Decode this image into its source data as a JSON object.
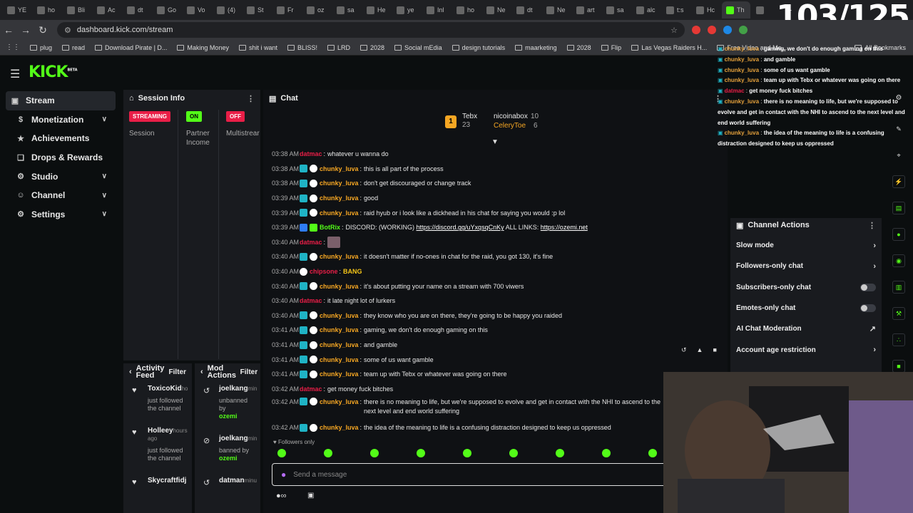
{
  "browser": {
    "tabs": [
      "YE",
      "ho",
      "Bli",
      "Ac",
      "dt",
      "Go",
      "Vo",
      "(4)",
      "St",
      "Fr",
      "oz",
      "sa",
      "He",
      "ye",
      "Inl",
      "ho",
      "Ne",
      "dt",
      "Ne",
      "art",
      "sa",
      "alc",
      "t:s",
      "Hc",
      "Th",
      ""
    ],
    "url": "dashboard.kick.com/stream",
    "bookmarks": [
      "plug",
      "read",
      "Download Pirate | D...",
      "Making Money",
      "shit i want",
      "BLISS!",
      "LRD",
      "2028",
      "Social mEdia",
      "design tutorials",
      "maarketing",
      "2028",
      "Flip",
      "Las Vegas Raiders H...",
      "Free Video and Me...",
      "All Bookmarks"
    ],
    "overlay_counter": "103/125"
  },
  "brand": {
    "logo": "KICK",
    "beta": "BETA",
    "accent": "#53fc18"
  },
  "sidebar": {
    "items": [
      {
        "label": "Stream",
        "icon": "stream-icon",
        "active": true
      },
      {
        "label": "Monetization",
        "icon": "dollar-icon",
        "expandable": true
      },
      {
        "label": "Achievements",
        "icon": "trophy-icon"
      },
      {
        "label": "Drops & Rewards",
        "icon": "gift-icon"
      },
      {
        "label": "Studio",
        "icon": "gear-icon",
        "expandable": true
      },
      {
        "label": "Channel",
        "icon": "person-icon",
        "expandable": true
      },
      {
        "label": "Settings",
        "icon": "settings-icon",
        "expandable": true
      }
    ]
  },
  "session": {
    "title": "Session Info",
    "cols": [
      {
        "pill": "STREAMING",
        "pill_color": "#e91e47",
        "label": "Session"
      },
      {
        "pill": "ON",
        "pill_color": "#53fc18",
        "label": "Partner Income"
      },
      {
        "pill": "OFF",
        "pill_color": "#e91e47",
        "label": "Multistrear"
      }
    ]
  },
  "activity": {
    "title": "Activity Feed",
    "filter": "Filter",
    "items": [
      {
        "name": "ToxicoKid",
        "suffix": "ho",
        "text": "just followed the channel"
      },
      {
        "name": "Holleey",
        "suffix": "hours ago",
        "text": "just followed the channel"
      },
      {
        "name": "Skycraftfidj",
        "suffix": "",
        "text": ""
      }
    ]
  },
  "modactions": {
    "title": "Mod Actions",
    "filter": "Filter",
    "items": [
      {
        "name": "joelkang",
        "suffix": "min",
        "text": "unbanned by",
        "by": "ozemi"
      },
      {
        "name": "joelkang",
        "suffix": "min",
        "text": "banned by",
        "by": "ozemi"
      },
      {
        "name": "datman",
        "suffix": "minu",
        "text": "",
        "by": ""
      }
    ]
  },
  "chat": {
    "title": "Chat",
    "pinned": {
      "rank1": "1",
      "user1": "Tebx",
      "count1": "23",
      "user2": "nicoinabox",
      "count2": "10",
      "user3": "CeleryToe",
      "count3": "6"
    },
    "messages": [
      {
        "ts": "03:38 AM",
        "user": "datmac",
        "color": "#e91e47",
        "badges": 0,
        "text": "whatever u wanna do"
      },
      {
        "ts": "03:38 AM",
        "user": "chunky_luva",
        "color": "#f5a623",
        "badges": 2,
        "text": "this is all part of the process"
      },
      {
        "ts": "03:38 AM",
        "user": "chunky_luva",
        "color": "#f5a623",
        "badges": 2,
        "text": "don't get discouraged or change track"
      },
      {
        "ts": "03:39 AM",
        "user": "chunky_luva",
        "color": "#f5a623",
        "badges": 2,
        "text": "good"
      },
      {
        "ts": "03:39 AM",
        "user": "chunky_luva",
        "color": "#f5a623",
        "badges": 2,
        "text": "raid hyub or i look like a dickhead in his chat for saying you would :p lol"
      },
      {
        "ts": "03:39 AM",
        "user": "BotRix",
        "color": "#53fc18",
        "badges": 2,
        "text": "DISCORD: (WORKING) ",
        "link1": "https://discord.gg/uYxqsqCnKy",
        "mid": " ALL LINKS: ",
        "link2": "https://ozemi.net"
      },
      {
        "ts": "03:40 AM",
        "user": "datmac",
        "color": "#e91e47",
        "badges": 0,
        "text": "",
        "emote": true
      },
      {
        "ts": "03:40 AM",
        "user": "chunky_luva",
        "color": "#f5a623",
        "badges": 2,
        "text": "it doesn't matter if no-ones in chat for the raid, you got 130, it's fine"
      },
      {
        "ts": "03:40 AM",
        "user": "chipsone",
        "color": "#e91e47",
        "badges": 1,
        "text": "BANG"
      },
      {
        "ts": "03:40 AM",
        "user": "chunky_luva",
        "color": "#f5a623",
        "badges": 2,
        "text": "it's about putting your name on a stream with 700 viwers"
      },
      {
        "ts": "03:40 AM",
        "user": "datmac",
        "color": "#e91e47",
        "badges": 0,
        "text": "it late night lot of lurkers"
      },
      {
        "ts": "03:40 AM",
        "user": "chunky_luva",
        "color": "#f5a623",
        "badges": 2,
        "text": "they know who you are on there, they're going to be happy you raided"
      },
      {
        "ts": "03:41 AM",
        "user": "chunky_luva",
        "color": "#f5a623",
        "badges": 2,
        "text": "gaming, we don't do enough gaming on this"
      },
      {
        "ts": "03:41 AM",
        "user": "chunky_luva",
        "color": "#f5a623",
        "badges": 2,
        "text": "and gamble"
      },
      {
        "ts": "03:41 AM",
        "user": "chunky_luva",
        "color": "#f5a623",
        "badges": 2,
        "text": "some of us want gamble"
      },
      {
        "ts": "03:41 AM",
        "user": "chunky_luva",
        "color": "#f5a623",
        "badges": 2,
        "text": "team up with Tebx or whatever was going on there"
      },
      {
        "ts": "03:42 AM",
        "user": "datmac",
        "color": "#e91e47",
        "badges": 0,
        "text": "get money fuck bitches"
      },
      {
        "ts": "03:42 AM",
        "user": "chunky_luva",
        "color": "#f5a623",
        "badges": 2,
        "text": "there is no meaning to life, but we're supposed to evolve and get in contact with the NHI to ascend to the next level and end world suffering",
        "wrap": true
      },
      {
        "ts": "03:42 AM",
        "user": "chunky_luva",
        "color": "#f5a623",
        "badges": 2,
        "text": "the idea of the meaning to life is a confusing distraction designed to keep us oppressed"
      }
    ],
    "followers_only": "Followers only",
    "input_placeholder": "Send a message"
  },
  "channel_actions": {
    "title": "Channel Actions",
    "rows": [
      {
        "label": "Slow mode",
        "control": "chevron"
      },
      {
        "label": "Followers-only chat",
        "control": "chevron"
      },
      {
        "label": "Subscribers-only chat",
        "control": "toggle"
      },
      {
        "label": "Emotes-only chat",
        "control": "toggle"
      },
      {
        "label": "AI Chat Moderation",
        "control": "external"
      },
      {
        "label": "Account age restriction",
        "control": "chevron"
      }
    ]
  },
  "overlay_chat": [
    {
      "user": "chunky_luva",
      "text": "gaming, we don't do enough gaming on this"
    },
    {
      "user": "chunky_luva",
      "text": "and gamble"
    },
    {
      "user": "chunky_luva",
      "text": "some of us want gamble"
    },
    {
      "user": "chunky_luva",
      "text": "team up with Tebx or whatever was going on there"
    },
    {
      "user": "datmac",
      "text": "get money fuck bitches"
    },
    {
      "user": "chunky_luva",
      "text": "there is no meaning to life, but we're supposed to evolve and get in contact with the NHI to ascend to the next level and end world suffering"
    },
    {
      "user": "chunky_luva",
      "text": "the idea of the meaning to life is a confusing distraction designed to keep us oppressed"
    }
  ]
}
